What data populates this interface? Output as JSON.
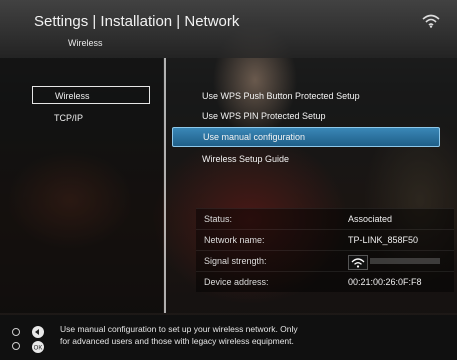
{
  "header": {
    "title": "Settings | Installation | Network",
    "subtitle": "Wireless",
    "wifi_icon": "wifi-icon"
  },
  "left_menu": {
    "items": [
      {
        "label": "Wireless",
        "active": true
      },
      {
        "label": "TCP/IP",
        "active": false
      }
    ]
  },
  "right_menu": {
    "items": [
      {
        "label": "Use WPS Push Button Protected Setup"
      },
      {
        "label": "Use WPS PIN Protected Setup"
      },
      {
        "label": "Use manual configuration",
        "selected": true
      },
      {
        "label": "Wireless Setup Guide"
      }
    ]
  },
  "info": {
    "status_label": "Status:",
    "status_value": "Associated",
    "network_label": "Network name:",
    "network_value": "TP-LINK_858F50",
    "signal_label": "Signal strength:",
    "signal_icon": "wifi-icon",
    "device_label": "Device address:",
    "device_value": "00:21:00:26:0F:F8"
  },
  "footer": {
    "icons": [
      "remote-up-down-icon",
      "ok-button-icon"
    ],
    "line1": "Use manual configuration to set up your wireless network. Only",
    "line2": "for advanced users and those with legacy wireless equipment."
  },
  "colors": {
    "selection": "#2a74a3",
    "selection_border": "#8ec8ea"
  }
}
